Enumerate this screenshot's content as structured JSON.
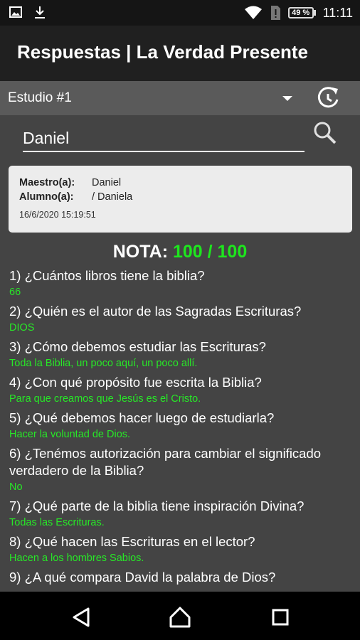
{
  "status_bar": {
    "left_icons": [
      "image-icon",
      "download-icon"
    ],
    "right_icons": [
      "wifi-icon",
      "sim-alert-icon",
      "battery-icon"
    ],
    "battery_text": "49 %",
    "time": "11:11"
  },
  "app_bar": {
    "title": "Respuestas | La Verdad Presente"
  },
  "study_selector": {
    "selected": "Estudio #1"
  },
  "search": {
    "value": "Daniel"
  },
  "info_card": {
    "teacher_label": "Maestro(a):",
    "teacher_value": "Daniel",
    "student_label": "Alumno(a):",
    "student_value": "/ Daniela",
    "timestamp": "16/6/2020 15:19:51"
  },
  "grade": {
    "label": "NOTA:",
    "value": "100 / 100"
  },
  "questions": [
    {
      "q": "1) ¿Cuántos libros tiene la biblia?",
      "a": "66"
    },
    {
      "q": "2) ¿Quién es el autor de las Sagradas Escrituras?",
      "a": "DIOS"
    },
    {
      "q": "3) ¿Cómo debemos estudiar las Escrituras?",
      "a": "Toda la Biblia, un poco aquí, un poco allí."
    },
    {
      "q": "4) ¿Con qué propósito fue escrita la Biblia?",
      "a": "Para que creamos que Jesús es el Cristo."
    },
    {
      "q": "5) ¿Qué debemos hacer luego de estudiarla?",
      "a": "Hacer la voluntad de Dios."
    },
    {
      "q": "6) ¿Tenémos autorización para cambiar el significado verdadero de la Biblia?",
      "a": "No"
    },
    {
      "q": "7) ¿Qué parte de la biblia tiene inspiración Divina?",
      "a": "Todas las Escrituras."
    },
    {
      "q": "8) ¿Qué hacen las Escrituras en el lector?",
      "a": "Hacen a los hombres Sabios."
    },
    {
      "q": "9) ¿A qué compara David la palabra de Dios?",
      "a": ""
    }
  ],
  "nav_bar": {
    "buttons": [
      "back-icon",
      "home-icon",
      "recents-icon"
    ]
  },
  "colors": {
    "answer": "#27e827",
    "grade_value": "#1ee61e",
    "background": "#444444"
  }
}
